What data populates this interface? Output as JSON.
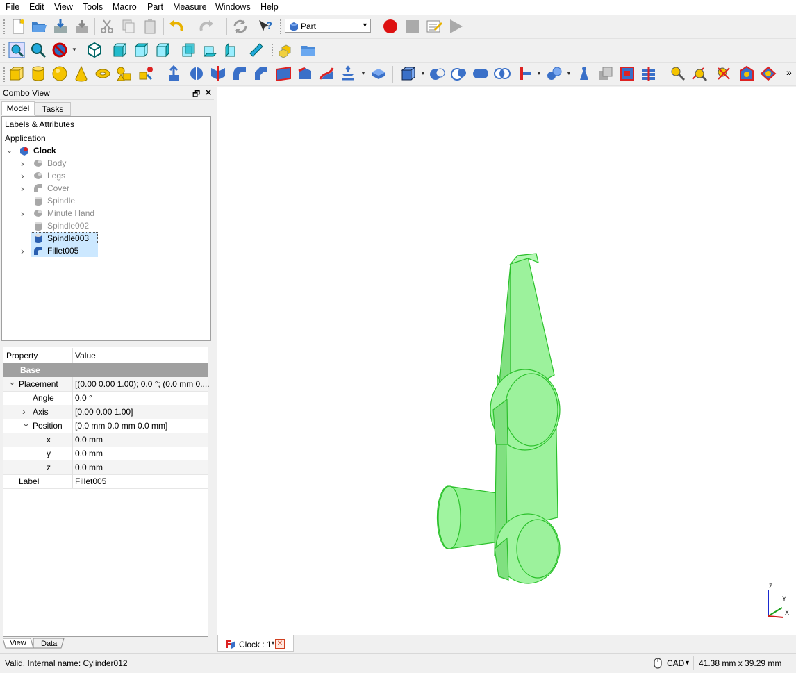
{
  "menu": [
    "File",
    "Edit",
    "View",
    "Tools",
    "Macro",
    "Part",
    "Measure",
    "Windows",
    "Help"
  ],
  "toolbar": {
    "workbench": "Part",
    "overflow": "»"
  },
  "combo": {
    "title": "Combo View",
    "tabs": [
      "Model",
      "Tasks"
    ],
    "tree_header": "Labels & Attributes",
    "application": "Application",
    "root": "Clock",
    "items": [
      {
        "label": "Body",
        "icon": "part-icon"
      },
      {
        "label": "Legs",
        "icon": "part-icon"
      },
      {
        "label": "Cover",
        "icon": "fillet-icon"
      },
      {
        "label": "Spindle",
        "icon": "cylinder-icon"
      },
      {
        "label": "Minute Hand",
        "icon": "part-icon"
      },
      {
        "label": "Spindle002",
        "icon": "cylinder-icon"
      },
      {
        "label": "Spindle003",
        "icon": "cylinder-icon"
      },
      {
        "label": "Fillet005",
        "icon": "fillet-icon"
      }
    ]
  },
  "props": {
    "col_property": "Property",
    "col_value": "Value",
    "group": "Base",
    "rows": [
      {
        "k": "Placement",
        "v": "[(0.00 0.00 1.00); 0.0 °; (0.0 mm  0...."
      },
      {
        "k": "Angle",
        "v": "0.0 °"
      },
      {
        "k": "Axis",
        "v": "[0.00 0.00 1.00]"
      },
      {
        "k": "Position",
        "v": "[0.0 mm  0.0 mm  0.0 mm]"
      },
      {
        "k": "x",
        "v": "0.0 mm"
      },
      {
        "k": "y",
        "v": "0.0 mm"
      },
      {
        "k": "z",
        "v": "0.0 mm"
      },
      {
        "k": "Label",
        "v": "Fillet005"
      }
    ],
    "bottom_tabs": [
      "View",
      "Data"
    ]
  },
  "view": {
    "axes": {
      "z": "Z",
      "y": "Y",
      "x": "X"
    },
    "doc_tab": "Clock : 1*"
  },
  "status": {
    "message": "Valid, Internal name: Cylinder012",
    "nav_style": "CAD",
    "dimensions": "41.38 mm x 39.29 mm"
  },
  "colors": {
    "model": "#90f090",
    "model_edge": "#2bc02b",
    "selection": "#cce8ff"
  }
}
